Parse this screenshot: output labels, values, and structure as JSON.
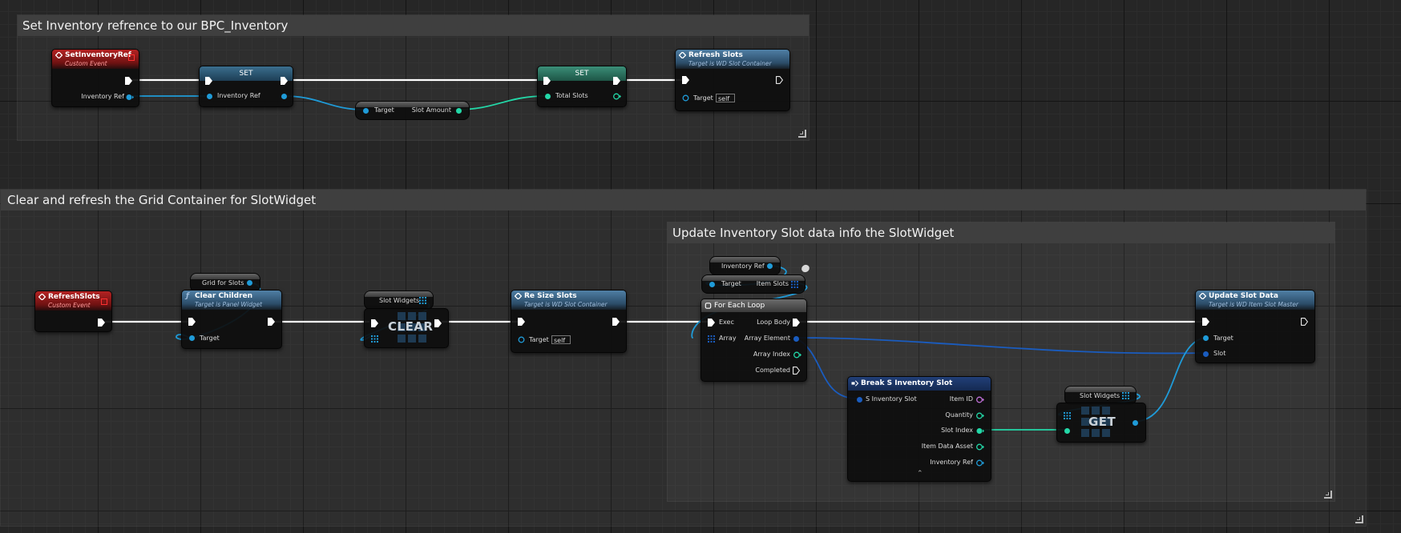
{
  "comments": {
    "c1": {
      "title": "Set Inventory refrence to our BPC_Inventory"
    },
    "c2": {
      "title": "Clear and refresh the Grid Container for SlotWidget"
    },
    "c3": {
      "title": "Update Inventory Slot data info the SlotWidget"
    }
  },
  "nodes": {
    "set_inventory_ref_event": {
      "title": "SetInventoryRef",
      "subtitle": "Custom Event",
      "pin_out": "Inventory Ref"
    },
    "set1": {
      "title": "SET",
      "pin_in": "Inventory Ref"
    },
    "slot_amount": {
      "target": "Target",
      "output": "Slot Amount"
    },
    "set2": {
      "title": "SET",
      "pin_in": "Total Slots"
    },
    "refresh_slots_call": {
      "title": "Refresh Slots",
      "subtitle": "Target is WD Slot Container",
      "target": "Target",
      "target_value": "self"
    },
    "refresh_slots_event": {
      "title": "RefreshSlots",
      "subtitle": "Custom Event"
    },
    "grid_for_slots": {
      "label": "Grid for Slots"
    },
    "clear_children": {
      "title": "Clear Children",
      "subtitle": "Target is Panel Widget",
      "target": "Target"
    },
    "slot_widgets_1": {
      "label": "Slot Widgets"
    },
    "clear": {
      "label": "CLEAR"
    },
    "resize_slots": {
      "title": "Re Size Slots",
      "subtitle": "Target is WD Slot Container",
      "target": "Target",
      "target_value": "self"
    },
    "inventory_ref_get": {
      "label": "Inventory Ref"
    },
    "item_slots": {
      "target": "Target",
      "output": "Item Slots"
    },
    "for_each": {
      "title": "For Each Loop",
      "exec": "Exec",
      "array": "Array",
      "loop_body": "Loop Body",
      "array_element": "Array Element",
      "array_index": "Array Index",
      "completed": "Completed"
    },
    "break_slot": {
      "title": "Break S Inventory Slot",
      "input": "S Inventory Slot",
      "outputs": [
        "Item ID",
        "Quantity",
        "Slot Index",
        "Item Data Asset",
        "Inventory Ref"
      ]
    },
    "slot_widgets_2": {
      "label": "Slot Widgets"
    },
    "get": {
      "label": "GET"
    },
    "update_slot_data": {
      "title": "Update Slot Data",
      "subtitle": "Target is WD Item Slot Master",
      "target": "Target",
      "slot": "Slot"
    }
  },
  "colors": {
    "exec": "#ffffff",
    "object": "#1f9bd8",
    "integer": "#23d8a8",
    "struct": "#1a5cbf",
    "name": "#c070d8"
  }
}
